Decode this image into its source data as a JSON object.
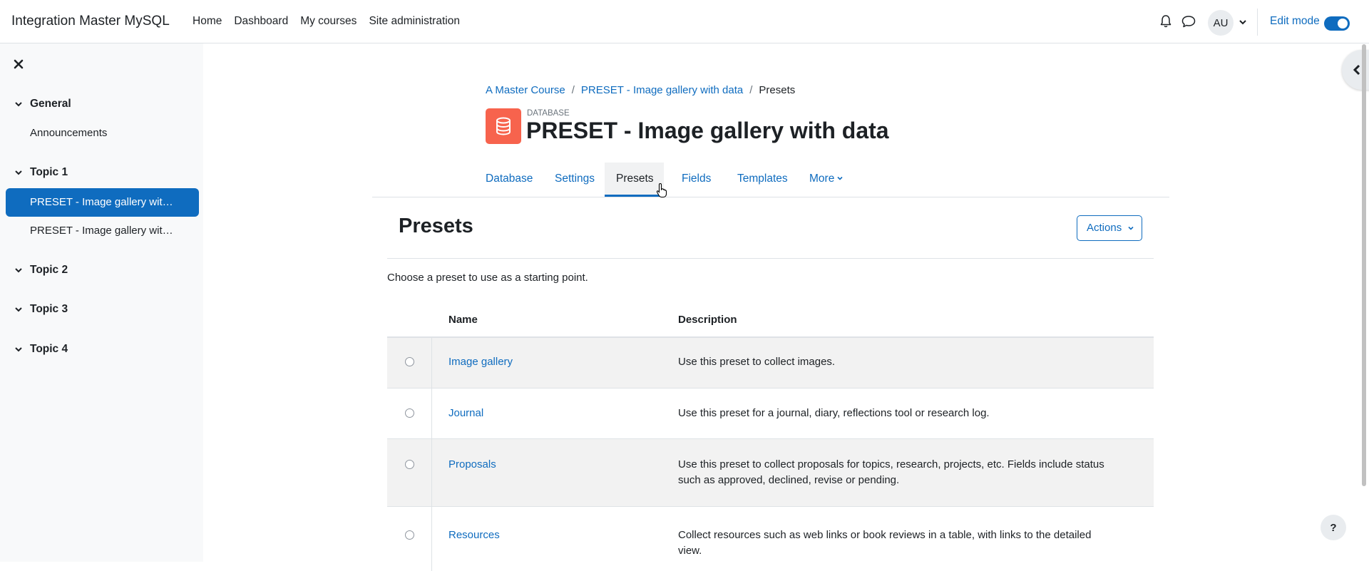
{
  "navbar": {
    "brand": "Integration Master MySQL",
    "links": [
      "Home",
      "Dashboard",
      "My courses",
      "Site administration"
    ],
    "avatar_initials": "AU",
    "edit_mode_label": "Edit mode",
    "edit_mode_on": true
  },
  "drawer": {
    "sections": [
      {
        "title": "General",
        "items": [
          "Announcements"
        ]
      },
      {
        "title": "Topic 1",
        "items": [
          "PRESET - Image gallery wit…",
          "PRESET - Image gallery wit…"
        ],
        "active_index": 0
      },
      {
        "title": "Topic 2",
        "items": []
      },
      {
        "title": "Topic 3",
        "items": []
      },
      {
        "title": "Topic 4",
        "items": []
      }
    ]
  },
  "breadcrumb": {
    "items": [
      "A Master Course",
      "PRESET - Image gallery with data",
      "Presets"
    ]
  },
  "module": {
    "type_label": "DATABASE",
    "title": "PRESET - Image gallery with data",
    "icon": "database-icon",
    "icon_color": "#f7634d"
  },
  "tabs": {
    "items": [
      "Database",
      "Settings",
      "Presets",
      "Fields",
      "Templates",
      "More"
    ],
    "active": "Presets"
  },
  "presets": {
    "heading": "Presets",
    "actions_label": "Actions",
    "intro": "Choose a preset to use as a starting point.",
    "columns": {
      "name": "Name",
      "description": "Description"
    },
    "rows": [
      {
        "name": "Image gallery",
        "description": "Use this preset to collect images."
      },
      {
        "name": "Journal",
        "description": "Use this preset for a journal, diary, reflections tool or research log."
      },
      {
        "name": "Proposals",
        "description": "Use this preset to collect proposals for topics, research, projects, etc. Fields include status such as approved, declined, revise or pending."
      },
      {
        "name": "Resources",
        "description": "Collect resources such as web links or book reviews in a table, with links to the detailed view."
      }
    ]
  },
  "help_label": "?",
  "colors": {
    "accent": "#0f6cbf",
    "drawer_bg": "#f8f9fa"
  }
}
